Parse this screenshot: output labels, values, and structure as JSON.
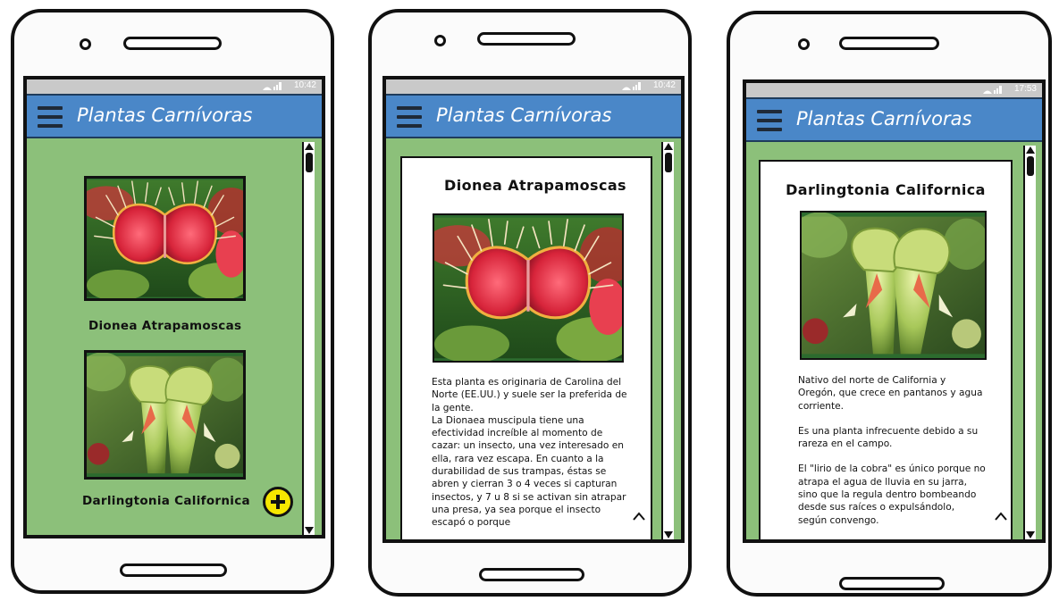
{
  "app": {
    "title": "Plantas Carnívoras"
  },
  "screens": [
    {
      "status_time": "10:42",
      "list_items": [
        {
          "label": "Dionea Atrapamoscas",
          "image_icon": "venus-flytrap-image"
        },
        {
          "label": "Darlingtonia Californica",
          "image_icon": "cobra-lily-image"
        }
      ],
      "fab_icon": "plus-icon"
    },
    {
      "status_time": "10:42",
      "detail": {
        "title": "Dionea Atrapamoscas",
        "image_icon": "venus-flytrap-image",
        "paragraphs": [
          "Esta planta es originaria de Carolina del Norte (EE.UU.) y suele ser la preferida de la gente.",
          "La Dionaea muscipula tiene una efectividad increíble al momento de cazar: un insecto, una vez interesado en ella, rara vez escapa. En cuanto a la durabilidad de sus trampas, éstas se abren y cierran 3 o 4 veces si capturan insectos, y 7 u 8 si se activan sin atrapar una presa, ya sea porque el insecto escapó o porque"
        ]
      }
    },
    {
      "status_time": "17:53",
      "detail": {
        "title": "Darlingtonia Californica",
        "image_icon": "cobra-lily-image",
        "paragraphs": [
          "Nativo del norte de California y Oregón, que crece en pantanos y agua corriente.",
          "Es una planta infrecuente debido a su rareza en el campo.",
          "El \"lirio de la cobra\" es único porque no atrapa el agua de lluvia en su jarra, sino que la regula dentro bombeando desde sus raíces o expulsándolo, según convengo."
        ]
      }
    }
  ],
  "colors": {
    "app_bar": "#4a87c8",
    "screen_bg": "#8cc07a",
    "fab": "#f6e600",
    "status_bar": "#c9c9c9"
  }
}
